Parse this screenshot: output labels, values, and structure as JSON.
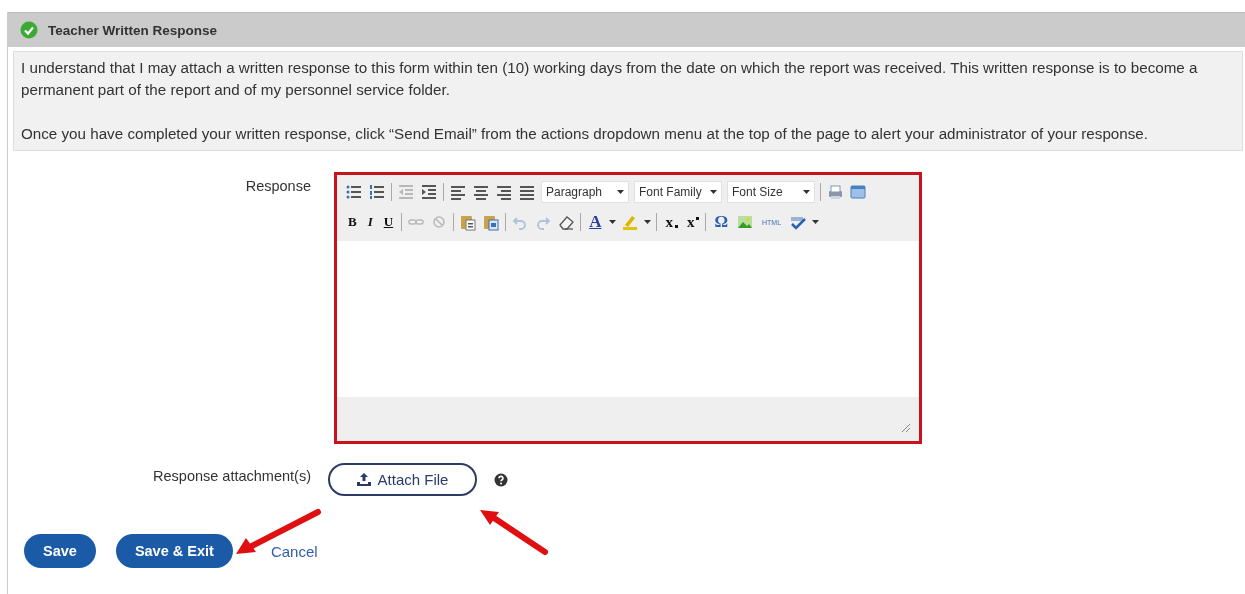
{
  "panel": {
    "title": "Teacher Written Response",
    "complete": true
  },
  "info": [
    "I understand that I may attach a written response to this form within ten (10) working days from the date on which the report was received. This written response is to become a permanent part of the report and of my personnel service folder.",
    "Once you have completed your written response, click “Send Email” from the actions dropdown menu at the top of the page to alert your administrator of your response."
  ],
  "response": {
    "label": "Response",
    "toolbar": [
      [
        {
          "kind": "icon",
          "disabled": false
        },
        {
          "kind": "icon",
          "disabled": false
        },
        {
          "kind": "sep"
        },
        {
          "kind": "icon",
          "disabled": true
        },
        {
          "kind": "icon",
          "disabled": false
        },
        {
          "kind": "sep"
        },
        {
          "kind": "icon",
          "disabled": false
        },
        {
          "kind": "icon",
          "disabled": false
        },
        {
          "kind": "icon",
          "disabled": false
        },
        {
          "kind": "icon",
          "disabled": false
        },
        {
          "kind": "select",
          "label": "Paragraph"
        },
        {
          "kind": "select",
          "label": "Font Family"
        },
        {
          "kind": "select",
          "label": "Font Size"
        },
        {
          "kind": "sep"
        },
        {
          "kind": "icon",
          "disabled": false
        },
        {
          "kind": "icon",
          "disabled": false
        }
      ],
      [
        {
          "kind": "bold",
          "label": "B"
        },
        {
          "kind": "italic",
          "label": "I"
        },
        {
          "kind": "underline",
          "label": "U"
        },
        {
          "kind": "sep"
        },
        {
          "kind": "icon",
          "disabled": true
        },
        {
          "kind": "icon",
          "disabled": true
        },
        {
          "kind": "sep"
        },
        {
          "kind": "icon",
          "disabled": false
        },
        {
          "kind": "icon",
          "disabled": false
        },
        {
          "kind": "sep"
        },
        {
          "kind": "icon",
          "disabled": true
        },
        {
          "kind": "icon",
          "disabled": true
        },
        {
          "kind": "icon",
          "disabled": false
        },
        {
          "kind": "sep"
        },
        {
          "kind": "color",
          "label": "A"
        },
        {
          "kind": "icon",
          "disabled": false
        },
        {
          "kind": "sep"
        },
        {
          "kind": "subscript",
          "label": "x"
        },
        {
          "kind": "superscript",
          "label": "x"
        },
        {
          "kind": "sep"
        },
        {
          "kind": "symbol",
          "label": "Ω"
        },
        {
          "kind": "icon",
          "disabled": false
        },
        {
          "kind": "html",
          "label": "HTML"
        },
        {
          "kind": "icon",
          "disabled": false
        }
      ]
    ]
  },
  "attachment": {
    "label": "Response attachment(s)",
    "button": "Attach File"
  },
  "actions": [
    {
      "label": "Save",
      "kind": "button"
    },
    {
      "label": "Save & Exit",
      "kind": "button"
    },
    {
      "label": "Cancel",
      "kind": "link"
    }
  ]
}
